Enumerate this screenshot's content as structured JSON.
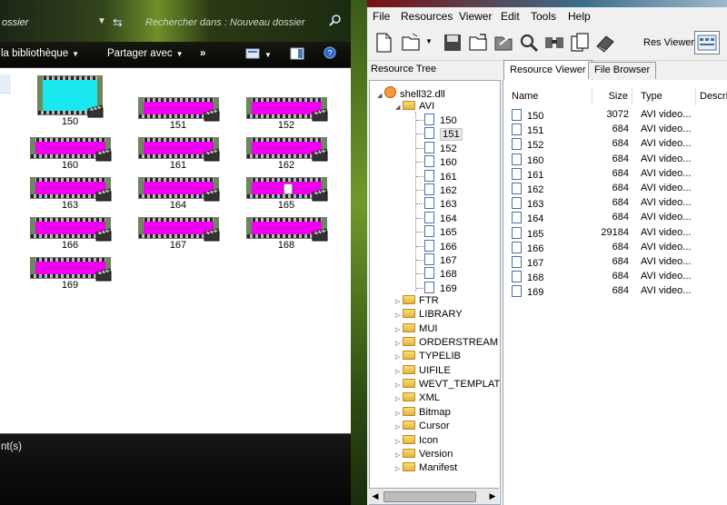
{
  "explorer": {
    "address_text": "ossier",
    "search_placeholder": "Rechercher dans : Nouveau dossier",
    "toolbar": {
      "library": "la bibliothèque",
      "share": "Partager avec",
      "more": "»"
    },
    "status_text": "nt(s)",
    "files": [
      {
        "label": "150",
        "color": "#19e9ef"
      },
      {
        "label": "151",
        "color": "#f000f0"
      },
      {
        "label": "152",
        "color": "#f000f0"
      },
      {
        "label": "160",
        "color": "#f000f0"
      },
      {
        "label": "161",
        "color": "#f000f0"
      },
      {
        "label": "162",
        "color": "#f000f0"
      },
      {
        "label": "163",
        "color": "#f000f0"
      },
      {
        "label": "164",
        "color": "#f000f0"
      },
      {
        "label": "165",
        "color": "#f000f0"
      },
      {
        "label": "166",
        "color": "#f000f0"
      },
      {
        "label": "167",
        "color": "#f000f0"
      },
      {
        "label": "168",
        "color": "#f000f0"
      },
      {
        "label": "169",
        "color": "#f000f0"
      }
    ]
  },
  "viewer": {
    "menu": [
      "File",
      "Resources",
      "Viewer",
      "Edit",
      "Tools",
      "Help"
    ],
    "res_viewer_label": "Res Viewer:",
    "tree_header": "Resource Tree",
    "tabs": [
      "Resource Viewer",
      "File Browser"
    ],
    "tree": {
      "root": "shell32.dll",
      "open_folder": "AVI",
      "avi_items": [
        "150",
        "151",
        "152",
        "160",
        "161",
        "162",
        "163",
        "164",
        "165",
        "166",
        "167",
        "168",
        "169"
      ],
      "selected": "151",
      "folders": [
        "FTR",
        "LIBRARY",
        "MUI",
        "ORDERSTREAM",
        "TYPELIB",
        "UIFILE",
        "WEVT_TEMPLAT",
        "XML",
        "Bitmap",
        "Cursor",
        "Icon",
        "Version",
        "Manifest"
      ]
    },
    "columns": [
      "Name",
      "Size",
      "Type",
      "Descri"
    ],
    "rows": [
      {
        "name": "150",
        "size": "3072",
        "type": "AVI video..."
      },
      {
        "name": "151",
        "size": "684",
        "type": "AVI video..."
      },
      {
        "name": "152",
        "size": "684",
        "type": "AVI video..."
      },
      {
        "name": "160",
        "size": "684",
        "type": "AVI video..."
      },
      {
        "name": "161",
        "size": "684",
        "type": "AVI video..."
      },
      {
        "name": "162",
        "size": "684",
        "type": "AVI video..."
      },
      {
        "name": "163",
        "size": "684",
        "type": "AVI video..."
      },
      {
        "name": "164",
        "size": "684",
        "type": "AVI video..."
      },
      {
        "name": "165",
        "size": "29184",
        "type": "AVI video..."
      },
      {
        "name": "166",
        "size": "684",
        "type": "AVI video..."
      },
      {
        "name": "167",
        "size": "684",
        "type": "AVI video..."
      },
      {
        "name": "168",
        "size": "684",
        "type": "AVI video..."
      },
      {
        "name": "169",
        "size": "684",
        "type": "AVI video..."
      }
    ]
  }
}
